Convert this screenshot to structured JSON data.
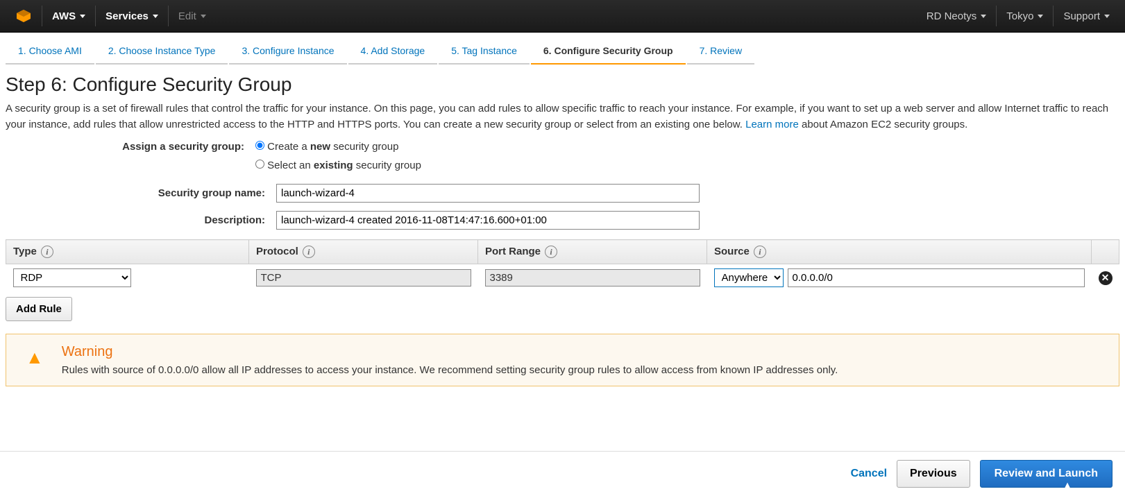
{
  "topbar": {
    "aws_label": "AWS",
    "services_label": "Services",
    "edit_label": "Edit",
    "account": "RD Neotys",
    "region": "Tokyo",
    "support": "Support"
  },
  "wizard": {
    "tabs": [
      "1. Choose AMI",
      "2. Choose Instance Type",
      "3. Configure Instance",
      "4. Add Storage",
      "5. Tag Instance",
      "6. Configure Security Group",
      "7. Review"
    ],
    "active_index": 5
  },
  "page": {
    "title": "Step 6: Configure Security Group",
    "intro_a": "A security group is a set of firewall rules that control the traffic for your instance. On this page, you can add rules to allow specific traffic to reach your instance. For example, if you want to set up a web server and allow Internet traffic to reach your instance, add rules that allow unrestricted access to the HTTP and HTTPS ports. You can create a new security group or select from an existing one below. ",
    "learn_more": "Learn more",
    "intro_b": " about Amazon EC2 security groups."
  },
  "form": {
    "assign_label": "Assign a security group:",
    "radio_new_pre": "Create a ",
    "radio_new_bold": "new",
    "radio_new_post": " security group",
    "radio_existing_pre": "Select an ",
    "radio_existing_bold": "existing",
    "radio_existing_post": " security group",
    "name_label": "Security group name:",
    "name_value": "launch-wizard-4",
    "desc_label": "Description:",
    "desc_value": "launch-wizard-4 created 2016-11-08T14:47:16.600+01:00"
  },
  "rules": {
    "headers": {
      "type": "Type",
      "protocol": "Protocol",
      "port": "Port Range",
      "source": "Source"
    },
    "rows": [
      {
        "type": "RDP",
        "protocol": "TCP",
        "port": "3389",
        "source_mode": "Anywhere",
        "source_cidr": "0.0.0.0/0"
      }
    ],
    "add_rule": "Add Rule"
  },
  "warning": {
    "title": "Warning",
    "text": "Rules with source of 0.0.0.0/0 allow all IP addresses to access your instance. We recommend setting security group rules to allow access from known IP addresses only."
  },
  "footer": {
    "cancel": "Cancel",
    "previous": "Previous",
    "review": "Review and Launch"
  }
}
